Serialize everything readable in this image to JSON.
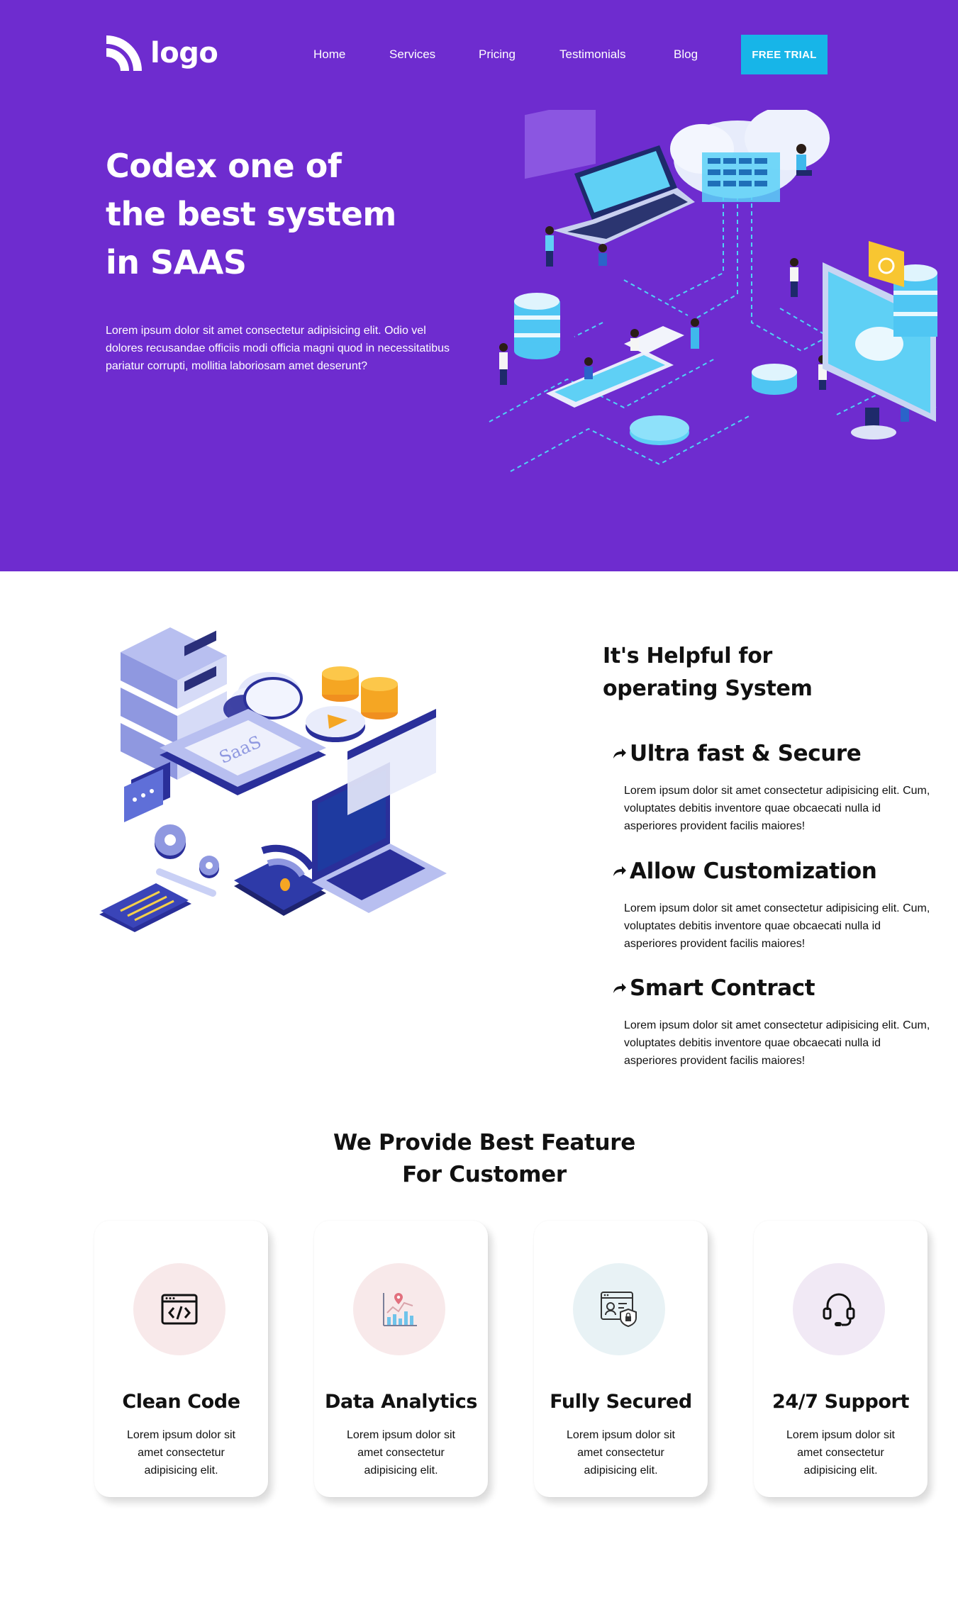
{
  "header": {
    "logo_text": "logo",
    "nav": [
      "Home",
      "Services",
      "Pricing",
      "Testimonials",
      "Blog"
    ],
    "cta_label": "FREE TRIAL"
  },
  "hero": {
    "title_lines": [
      "Codex one of",
      "the best system",
      "in SAAS"
    ],
    "description": "Lorem ipsum dolor sit amet consectetur adipisicing elit. Odio vel dolores recusandae officiis modi officia magni quod in necessitatibus pariatur corrupti, mollitia laboriosam amet deserunt?"
  },
  "helpful": {
    "title_lines": [
      "It's Helpful for",
      "operating System"
    ],
    "illustration_label": "SaaS",
    "items": [
      {
        "title": "Ultra fast & Secure",
        "text": "Lorem ipsum dolor sit amet consectetur adipisicing elit. Cum, voluptates debitis inventore quae obcaecati nulla id asperiores provident facilis maiores!"
      },
      {
        "title": "Allow Customization",
        "text": "Lorem ipsum dolor sit amet consectetur adipisicing elit. Cum, voluptates debitis inventore quae obcaecati nulla id asperiores provident facilis maiores!"
      },
      {
        "title": "Smart Contract",
        "text": "Lorem ipsum dolor sit amet consectetur adipisicing elit. Cum, voluptates debitis inventore quae obcaecati nulla id asperiores provident facilis maiores!"
      }
    ]
  },
  "features": {
    "title_lines": [
      "We Provide Best Feature",
      "For Customer"
    ],
    "cards": [
      {
        "title": "Clean Code",
        "text": "Lorem ipsum dolor sit amet consectetur adipisicing elit.",
        "icon": "code-window-icon",
        "icon_bg": "#f8e9ea"
      },
      {
        "title": "Data Analytics",
        "text": "Lorem ipsum dolor sit amet consectetur adipisicing elit.",
        "icon": "analytics-chart-icon",
        "icon_bg": "#f8e9ea"
      },
      {
        "title": "Fully Secured",
        "text": "Lorem ipsum dolor sit amet consectetur adipisicing elit.",
        "icon": "security-shield-icon",
        "icon_bg": "#e8f2f5"
      },
      {
        "title": "24/7 Support",
        "text": "Lorem ipsum dolor sit amet consectetur adipisicing elit.",
        "icon": "headset-icon",
        "icon_bg": "#f1e9f5"
      }
    ]
  },
  "colors": {
    "hero_bg": "#6e2ccf",
    "cta_bg": "#17b5e8",
    "text_dark": "#111111"
  }
}
